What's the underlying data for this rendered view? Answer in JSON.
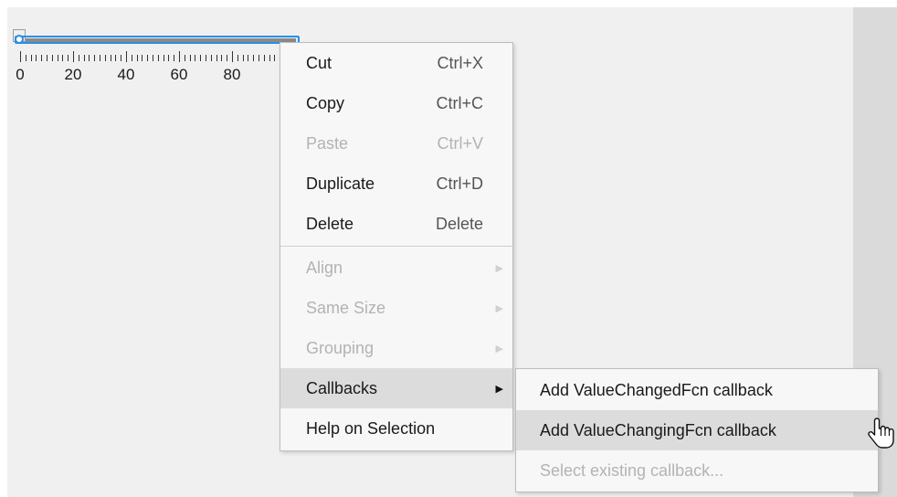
{
  "slider": {
    "tick_labels": [
      "0",
      "20",
      "40",
      "60",
      "80"
    ]
  },
  "context_menu": {
    "items": [
      {
        "label": "Cut",
        "shortcut": "Ctrl+X",
        "enabled": true
      },
      {
        "label": "Copy",
        "shortcut": "Ctrl+C",
        "enabled": true
      },
      {
        "label": "Paste",
        "shortcut": "Ctrl+V",
        "enabled": false
      },
      {
        "label": "Duplicate",
        "shortcut": "Ctrl+D",
        "enabled": true
      },
      {
        "label": "Delete",
        "shortcut": "Delete",
        "enabled": true
      },
      {
        "label": "Align",
        "submenu": true,
        "enabled": false
      },
      {
        "label": "Same Size",
        "submenu": true,
        "enabled": false
      },
      {
        "label": "Grouping",
        "submenu": true,
        "enabled": false
      },
      {
        "label": "Callbacks",
        "submenu": true,
        "enabled": true,
        "highlighted": true
      },
      {
        "label": "Help on Selection",
        "enabled": true
      }
    ]
  },
  "callbacks_submenu": {
    "items": [
      {
        "label": "Add ValueChangedFcn callback",
        "enabled": true
      },
      {
        "label": "Add ValueChangingFcn callback",
        "enabled": true,
        "highlighted": true
      },
      {
        "label": "Select existing callback...",
        "enabled": false
      }
    ]
  },
  "colors": {
    "selection_accent": "#2a8fe6",
    "canvas_background": "#f0f0f0",
    "menu_background": "#f7f7f7",
    "menu_highlight": "#dcdcdc",
    "disabled_text": "#b3b3b3"
  },
  "icons": {
    "submenu_arrow": "chevron-right-icon",
    "cursor": "hand-pointer-icon"
  }
}
